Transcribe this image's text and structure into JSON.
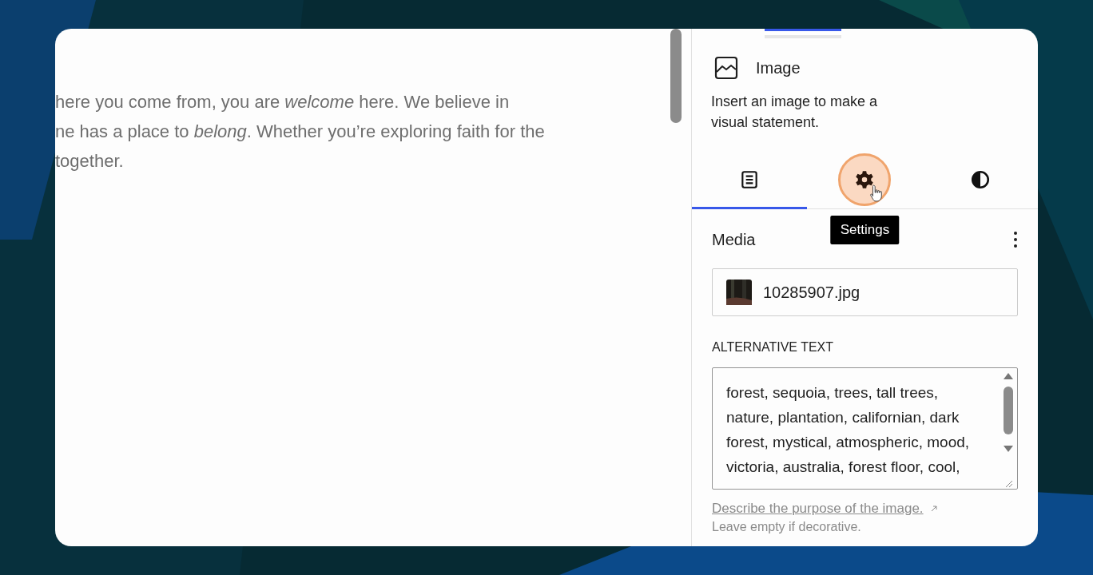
{
  "editor": {
    "lines": [
      "here you come from, you are *welcome* here. We believe in",
      "ne has a place to *belong*. Whether you’re exploring faith for the",
      "together."
    ]
  },
  "block_card": {
    "title": "Image",
    "description": "Insert an image to make a visual statement."
  },
  "tabs": [
    {
      "kind": "list",
      "selected": true
    },
    {
      "kind": "settings",
      "selected": false,
      "hovered": true,
      "tooltip": "Settings"
    },
    {
      "kind": "contrast",
      "selected": false
    }
  ],
  "media": {
    "title": "Media",
    "file_name": "10285907.jpg"
  },
  "alt_text": {
    "label": "ALTERNATIVE TEXT",
    "value": "forest, sequoia, trees, tall trees, nature, plantation, californian, dark forest, mystical, atmospheric, mood, victoria, australia, forest floor, cool,",
    "help_link": "Describe the purpose of the image.",
    "help_note": "Leave empty if decorative."
  }
}
